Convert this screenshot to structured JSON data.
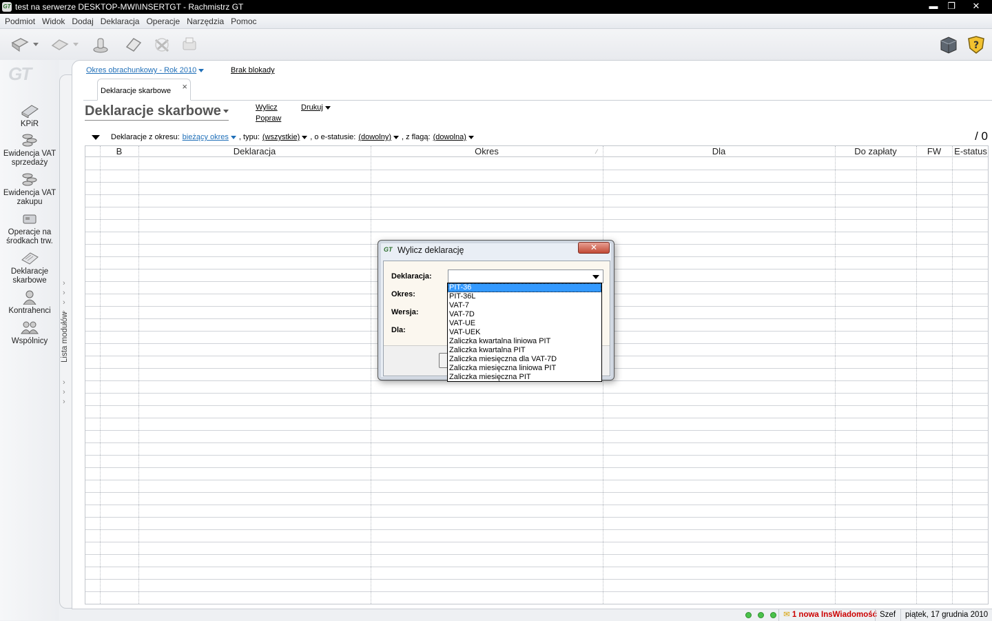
{
  "window": {
    "title": "test na serwerze DESKTOP-MWI\\INSERTGT - Rachmistrz GT",
    "icon_text": "GT",
    "buttons": {
      "minimize": "▬",
      "maximize": "❐",
      "close": "✕"
    }
  },
  "menu": [
    "Podmiot",
    "Widok",
    "Dodaj",
    "Deklaracja",
    "Operacje",
    "Narzędzia",
    "Pomoc"
  ],
  "toolbar": {
    "icons": [
      "open-icon",
      "send-icon",
      "stamp-icon",
      "eraser-icon",
      "tools-icon",
      "print-icon",
      "cube-icon",
      "help-shield-icon"
    ],
    "help_label": "?"
  },
  "left_panel": {
    "logo": "GT",
    "modules": [
      {
        "label": "KPiR"
      },
      {
        "label": "Ewidencja VAT sprzedaży"
      },
      {
        "label": "Ewidencja VAT zakupu"
      },
      {
        "label": "Operacje na środkach trw."
      },
      {
        "label": "Deklaracje skarbowe"
      },
      {
        "label": "Kontrahenci"
      },
      {
        "label": "Wspólnicy"
      }
    ],
    "strip_label": "Lista modułów"
  },
  "top_info": {
    "period_link": "Okres obrachunkowy - Rok 2010",
    "lock_status": "Brak blokady"
  },
  "tab": {
    "label": "Deklaracje skarbowe",
    "close": "×"
  },
  "page": {
    "title": "Deklaracje skarbowe",
    "actions": {
      "calculate": "Wylicz",
      "fix": "Popraw",
      "print": "Drukuj"
    }
  },
  "filter": {
    "from_label": "Deklaracje z okresu:",
    "from_value": "bieżący okres",
    "type_label": ", typu:",
    "type_value": "(wszystkie)",
    "status_label": ", o e-statusie:",
    "status_value": "(dowolny)",
    "flag_label": ", z flagą:",
    "flag_value": "(dowolna)",
    "count": "/ 0"
  },
  "table": {
    "columns": [
      "B",
      "Deklaracja",
      "Okres",
      "Dla",
      "Do zapłaty",
      "FW",
      "E-status"
    ],
    "sort_marker": "⁄"
  },
  "statusbar": {
    "messages": "1 nowa InsWiadomość",
    "user": "Szef",
    "date": "piątek, 17 grudnia 2010"
  },
  "dialog": {
    "title": "Wylicz deklarację",
    "close": "✕",
    "fields": {
      "declaration": "Deklaracja:",
      "period": "Okres:",
      "version": "Wersja:",
      "for": "Dla:"
    },
    "declaration_value": "",
    "options": [
      "PIT-36",
      "PIT-36L",
      "VAT-7",
      "VAT-7D",
      "VAT-UE",
      "VAT-UEK",
      "Zaliczka kwartalna liniowa PIT",
      "Zaliczka kwartalna PIT",
      "Zaliczka miesięczna dla VAT-7D",
      "Zaliczka miesięczna liniowa PIT",
      "Zaliczka miesięczna PIT"
    ],
    "highlighted_option": "PIT-36"
  }
}
